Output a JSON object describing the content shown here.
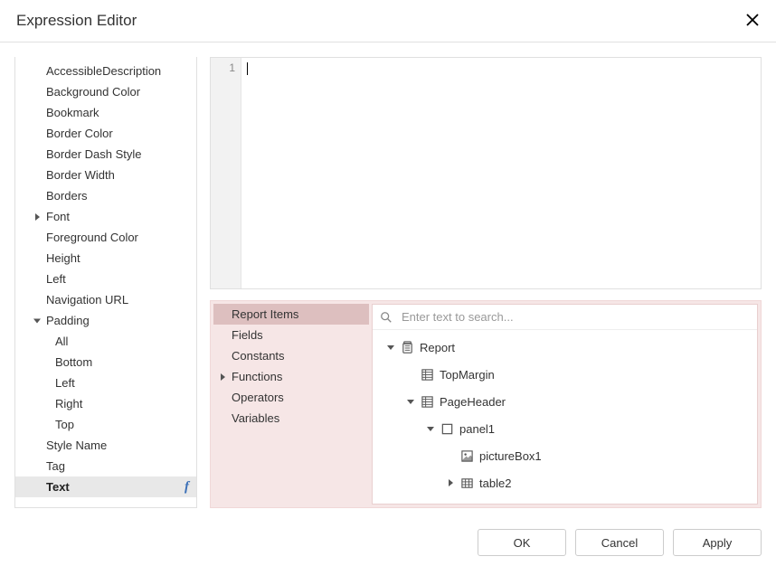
{
  "dialog": {
    "title": "Expression Editor"
  },
  "properties": [
    {
      "label": "AccessibleDescription",
      "expandable": false
    },
    {
      "label": "Background Color",
      "expandable": false
    },
    {
      "label": "Bookmark",
      "expandable": false
    },
    {
      "label": "Border Color",
      "expandable": false
    },
    {
      "label": "Border Dash Style",
      "expandable": false
    },
    {
      "label": "Border Width",
      "expandable": false
    },
    {
      "label": "Borders",
      "expandable": false
    },
    {
      "label": "Font",
      "expandable": true,
      "expanded": false
    },
    {
      "label": "Foreground Color",
      "expandable": false
    },
    {
      "label": "Height",
      "expandable": false
    },
    {
      "label": "Left",
      "expandable": false
    },
    {
      "label": "Navigation URL",
      "expandable": false
    },
    {
      "label": "Padding",
      "expandable": true,
      "expanded": true,
      "children": [
        {
          "label": "All"
        },
        {
          "label": "Bottom"
        },
        {
          "label": "Left"
        },
        {
          "label": "Right"
        },
        {
          "label": "Top"
        }
      ]
    },
    {
      "label": "Style Name",
      "expandable": false
    },
    {
      "label": "Tag",
      "expandable": false
    },
    {
      "label": "Text",
      "expandable": false,
      "selected": true,
      "fx": true
    }
  ],
  "editor": {
    "line_number": "1",
    "content": ""
  },
  "categories": [
    {
      "label": "Report Items",
      "selected": true
    },
    {
      "label": "Fields"
    },
    {
      "label": "Constants"
    },
    {
      "label": "Functions",
      "expandable": true
    },
    {
      "label": "Operators"
    },
    {
      "label": "Variables"
    }
  ],
  "search": {
    "placeholder": "Enter text to search..."
  },
  "tree": [
    {
      "label": "Report",
      "depth": 0,
      "icon": "report",
      "arrow": "expanded"
    },
    {
      "label": "TopMargin",
      "depth": 1,
      "icon": "band",
      "arrow": ""
    },
    {
      "label": "PageHeader",
      "depth": 1,
      "icon": "band",
      "arrow": "expanded"
    },
    {
      "label": "panel1",
      "depth": 2,
      "icon": "panel",
      "arrow": "expanded"
    },
    {
      "label": "pictureBox1",
      "depth": 3,
      "icon": "picture",
      "arrow": ""
    },
    {
      "label": "table2",
      "depth": 3,
      "icon": "table",
      "arrow": "collapsed"
    }
  ],
  "buttons": {
    "ok": "OK",
    "cancel": "Cancel",
    "apply": "Apply"
  }
}
